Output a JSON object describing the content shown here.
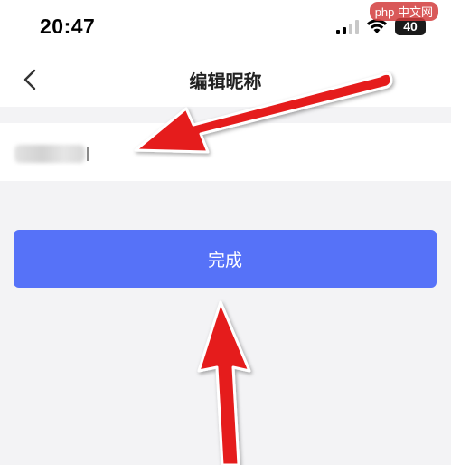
{
  "status_bar": {
    "time": "20:47",
    "battery": "40",
    "watermark": "php 中文网"
  },
  "nav": {
    "title": "编辑昵称",
    "back_icon": "chevron-left-icon"
  },
  "form": {
    "nickname_value": "",
    "nickname_placeholder": ""
  },
  "actions": {
    "done_label": "完成"
  },
  "colors": {
    "primary": "#5672f8",
    "arrow": "#e51b1b",
    "background": "#f3f3f5"
  }
}
